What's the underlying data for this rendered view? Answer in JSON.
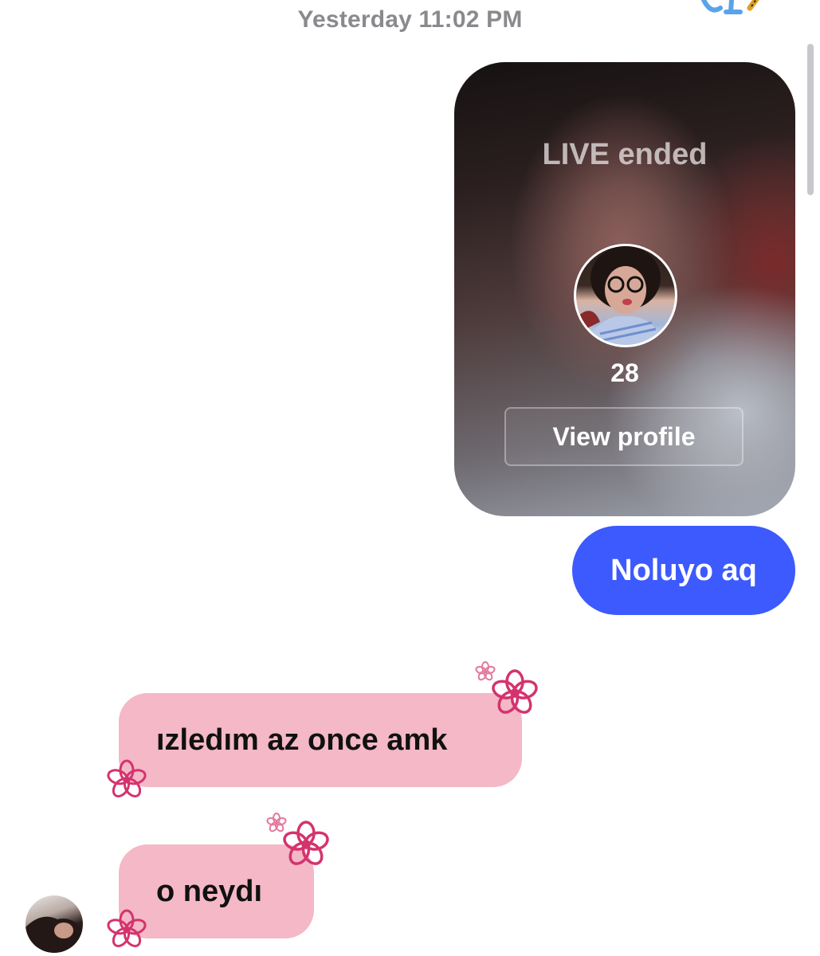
{
  "thread": {
    "timestamp": "Yesterday 11:02 PM"
  },
  "live_card": {
    "status": "LIVE ended",
    "count": "28",
    "button_label": "View profile",
    "avatar_icon": "profile-avatar"
  },
  "messages": [
    {
      "direction": "sent",
      "text": "Noluyo aq"
    },
    {
      "direction": "received",
      "text": "ızledım az once amk"
    },
    {
      "direction": "received",
      "text": "o neydı"
    }
  ],
  "colors": {
    "sent_bubble": "#3d5afe",
    "received_bubble": "#f4b8c7",
    "flower": "#d4336e",
    "timestamp_text": "#8a8a8e"
  }
}
